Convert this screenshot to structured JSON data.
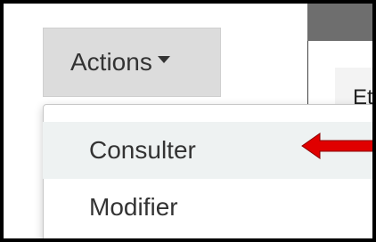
{
  "toolbar": {
    "actions_label": "Actions",
    "caret_icon": "caret-down-icon"
  },
  "menu": {
    "items": [
      {
        "label": "Consulter",
        "highlighted": true
      },
      {
        "label": "Modifier",
        "highlighted": false
      }
    ]
  },
  "panel": {
    "heading_partial": "Et"
  },
  "annotation": {
    "arrow_icon": "arrow-left-icon",
    "arrow_color": "#e00000"
  },
  "colors": {
    "frame_border": "#000000",
    "button_bg": "#dcdcdc",
    "highlight_bg": "#eef2f2",
    "top_bar": "#6e6e6e"
  }
}
